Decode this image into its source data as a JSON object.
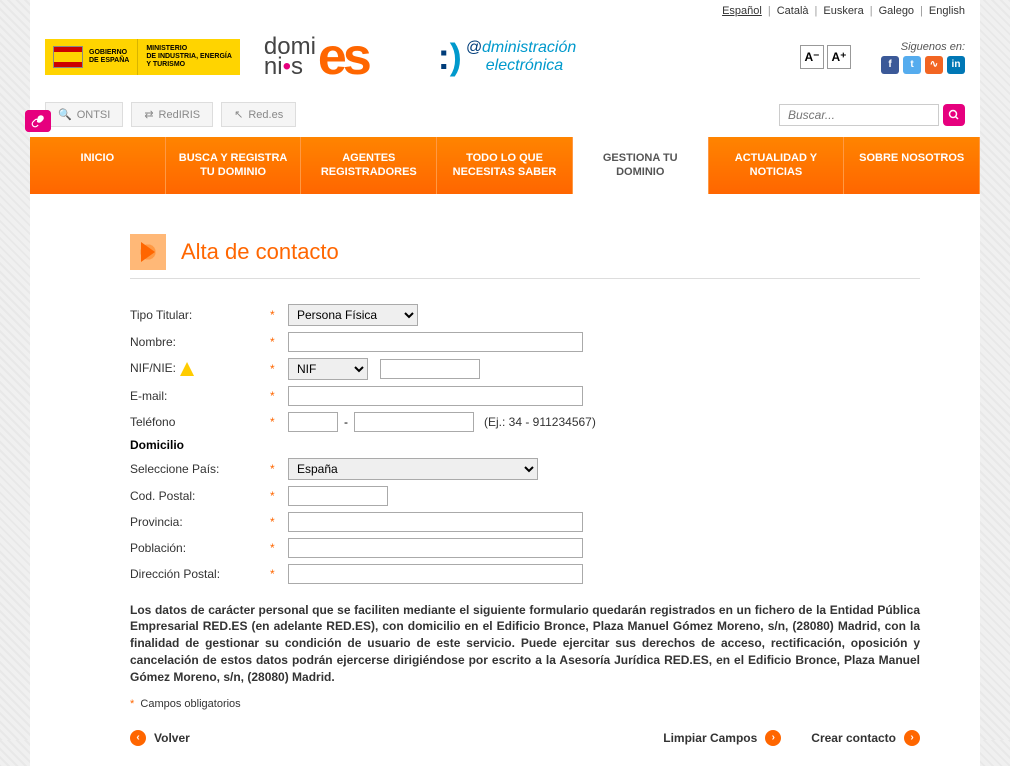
{
  "lang_links": [
    "Español",
    "Català",
    "Euskera",
    "Galego",
    "English"
  ],
  "active_lang_index": 0,
  "header": {
    "gobierno": "GOBIERNO\nDE ESPAÑA",
    "ministerio": "MINISTERIO\nDE INDUSTRIA, ENERGÍA\nY TURISMO",
    "admin_line1": "@dministración",
    "admin_line2": "electrónica",
    "siguenos": "Siguenos en:",
    "font_minus": "A⁻",
    "font_plus": "A⁺"
  },
  "subnav": {
    "ontsi": "ONTSI",
    "rediris": "RedIRIS",
    "redes": "Red.es"
  },
  "search_placeholder": "Buscar...",
  "nav": {
    "inicio": "INICIO",
    "busca": "BUSCA Y REGISTRA TU DOMINIO",
    "agentes": "AGENTES REGISTRADORES",
    "todo": "TODO LO QUE NECESITAS SABER",
    "gestiona": "GESTIONA TU DOMINIO",
    "actualidad": "ACTUALIDAD Y NOTICIAS",
    "sobre": "SOBRE NOSOTROS"
  },
  "page_title": "Alta de contacto",
  "form": {
    "tipo_titular_label": "Tipo Titular:",
    "tipo_titular_value": "Persona Física",
    "nombre_label": "Nombre:",
    "nombre_value": "",
    "nif_label": "NIF/NIE:",
    "nif_type_value": "NIF",
    "nif_value": "",
    "email_label": "E-mail:",
    "email_value": "",
    "telefono_label": "Teléfono",
    "tel_prefix_value": "",
    "tel_number_value": "",
    "tel_hint": "(Ej.: 34 - 911234567)",
    "domicilio_head": "Domicilio",
    "pais_label": "Seleccione País:",
    "pais_value": "España",
    "cp_label": "Cod. Postal:",
    "cp_value": "",
    "provincia_label": "Provincia:",
    "provincia_value": "",
    "poblacion_label": "Población:",
    "poblacion_value": "",
    "direccion_label": "Dirección Postal:",
    "direccion_value": ""
  },
  "legal_text": "Los datos de carácter personal que se faciliten mediante el siguiente formulario quedarán registrados en un fichero de la Entidad Pública Empresarial RED.ES (en adelante RED.ES), con domicilio en el Edificio Bronce, Plaza Manuel Gómez Moreno, s/n, (28080) Madrid, con la finalidad de gestionar su condición de usuario de este servicio. Puede ejercitar sus derechos de acceso, rectificación, oposición y cancelación de estos datos podrán ejercerse dirigiéndose por escrito a la Asesoría Jurídica RED.ES, en el Edificio Bronce, Plaza Manuel Gómez Moreno, s/n, (28080) Madrid.",
  "required_note": "Campos obligatorios",
  "actions": {
    "volver": "Volver",
    "limpiar": "Limpiar Campos",
    "crear": "Crear contacto"
  }
}
